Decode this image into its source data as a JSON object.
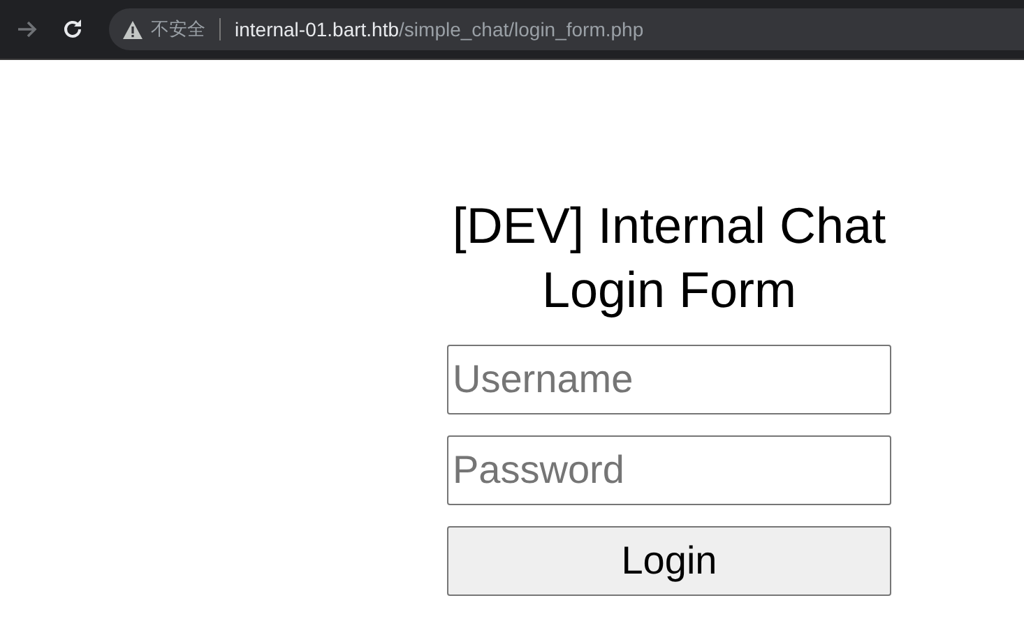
{
  "toolbar": {
    "forward_disabled": true,
    "security_label": "不安全",
    "url_host": "internal-01.bart.htb",
    "url_path": "/simple_chat/login_form.php"
  },
  "form": {
    "title": "[DEV] Internal Chat Login Form",
    "fields": [
      {
        "placeholder": "Username"
      },
      {
        "placeholder": "Password"
      }
    ],
    "submit": "Login"
  }
}
